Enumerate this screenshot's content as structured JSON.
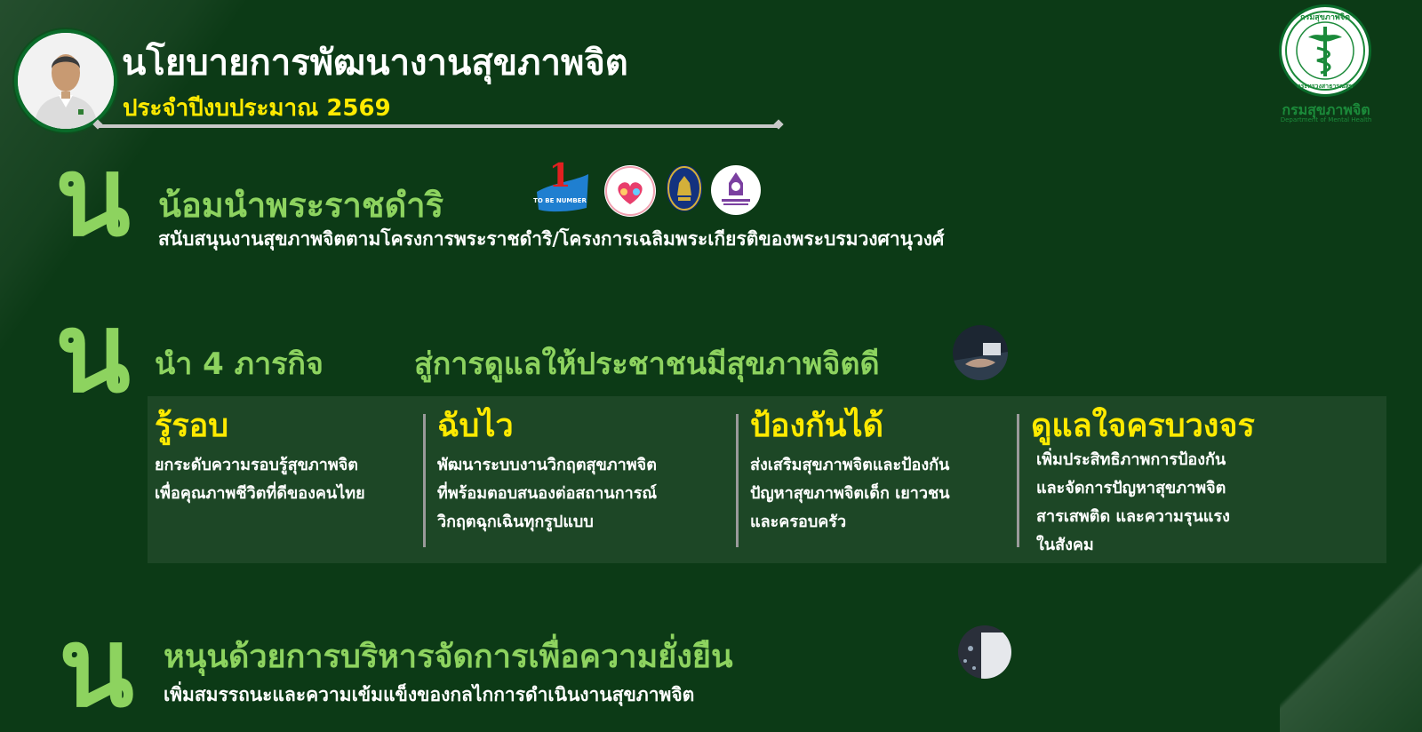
{
  "header": {
    "title": "นโยบายการพัฒนางานสุขภาพจิต",
    "subtitle": "ประจำปีงบประมาณ 2569"
  },
  "logo": {
    "name": "กรมสุขภาพจิต",
    "sub": "Department of Mental Health",
    "seal_top": "กรมสุขภาพจิต",
    "seal_bottom": "กระทรวงสาธารณสุข"
  },
  "sections": [
    {
      "letter": "น",
      "title": "น้อมนำพระราชดำริ",
      "desc": "สนับสนุนงานสุขภาพจิตตามโครงการพระราชดำริ/โครงการเฉลิมพระเกียรติของพระบรมวงศานุวงศ์",
      "badges": [
        "to-be-number-one-logo",
        "family-heart-logo",
        "royal-emblem-logo",
        "princess-project-logo"
      ]
    },
    {
      "letter": "น",
      "title_prefix": "นำ  4 ภารกิจ",
      "title_suffix": "สู่การดูแลให้ประชาชนมีสุขภาพจิตดี",
      "missions": [
        {
          "title": "รู้รอบ",
          "lines": [
            "ยกระดับความรอบรู้สุขภาพจิต",
            "เพื่อคุณภาพชีวิตที่ดีของคนไทย"
          ]
        },
        {
          "title": "ฉับไว",
          "lines": [
            "พัฒนาระบบงานวิกฤตสุขภาพจิต",
            "ที่พร้อมตอบสนองต่อสถานการณ์",
            "วิกฤตฉุกเฉินทุกรูปแบบ"
          ]
        },
        {
          "title": "ป้องกันได้",
          "lines": [
            "ส่งเสริมสุขภาพจิตและป้องกัน",
            "ปัญหาสุขภาพจิตเด็ก เยาวชน",
            "และครอบครัว"
          ]
        },
        {
          "title": "ดูแลใจครบวงจร",
          "lines": [
            "เพิ่มประสิทธิภาพการป้องกัน",
            "และจัดการปัญหาสุขภาพจิต",
            "สารเสพติด และความรุนแรง",
            "ในสังคม"
          ]
        }
      ]
    },
    {
      "letter": "น",
      "title": "หนุนด้วยการบริหารจัดการเพื่อความยั่งยืน",
      "desc": "เพิ่มสมรรถนะและความเข้มแข็งของกลไกการดำเนินงานสุขภาพจิต"
    }
  ],
  "badge_texts": {
    "number_one": "1",
    "to_be": "TO BE NUMBER"
  },
  "colors": {
    "background": "#0c3a16",
    "accent_green": "#8dd35f",
    "accent_yellow": "#ffea00",
    "logo_green": "#1b8a3a"
  }
}
